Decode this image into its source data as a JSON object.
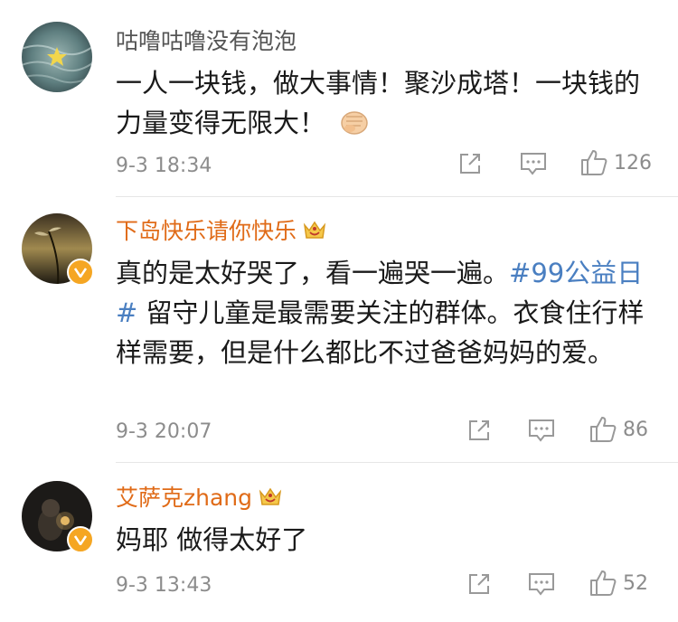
{
  "comments": [
    {
      "username": "咕噜咕噜没有泡泡",
      "text": "一人一块钱，做大事情！聚沙成塔！一块钱的力量变得无限大！",
      "time": "9-3 18:34",
      "likes": "126",
      "avatar_icon": "sea-avatar",
      "username_color": "#555555"
    },
    {
      "username": "下岛快乐请你快乐",
      "text_before": "真的是太好哭了，看一遍哭一遍。",
      "topic": "#99公益日#",
      "text_after": " 留守儿童是最需要关注的群体。衣食住行样样需要，但是什么都比不过爸爸妈妈的爱。",
      "time": "9-3 20:07",
      "likes": "86",
      "avatar_icon": "reed-avatar",
      "username_color": "#e06b18"
    },
    {
      "username": "艾萨克zhang",
      "text": "妈耶 做得太好了",
      "time": "9-3 13:43",
      "likes": "52",
      "avatar_icon": "dark-portrait-avatar",
      "username_color": "#e06b18"
    }
  ],
  "colors": {
    "topic_link": "#4a7fc1",
    "verified_badge": "#f5a623",
    "meta_gray": "#8c8c8c"
  }
}
